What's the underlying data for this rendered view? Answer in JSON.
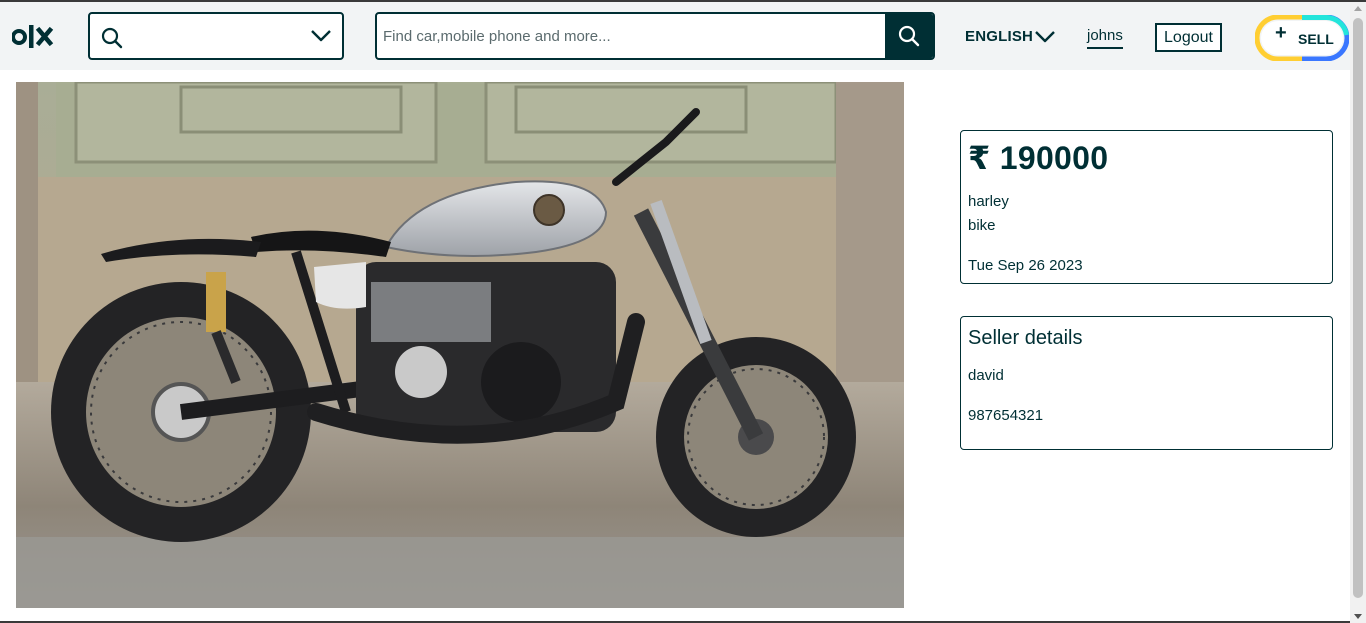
{
  "header": {
    "logo_icon": "olx-logo",
    "location_placeholder": "",
    "search_placeholder": "Find car,mobile phone and more...",
    "language": "ENGLISH",
    "username": "johns",
    "logout_label": "Logout",
    "sell_label": "SELL",
    "sell_plus": "+"
  },
  "product": {
    "image_alt": "motorcycle-photo",
    "price": "₹ 190000",
    "name": "harley",
    "category": "bike",
    "date": "Tue Sep 26 2023"
  },
  "seller": {
    "title": "Seller details",
    "name": "david",
    "phone": "987654321"
  },
  "colors": {
    "brand": "#002f34",
    "header_bg": "#f2f4f5",
    "sell_ring_yellow": "#ffce32",
    "sell_ring_blue": "#3a77ff",
    "sell_ring_teal": "#23e5db"
  }
}
